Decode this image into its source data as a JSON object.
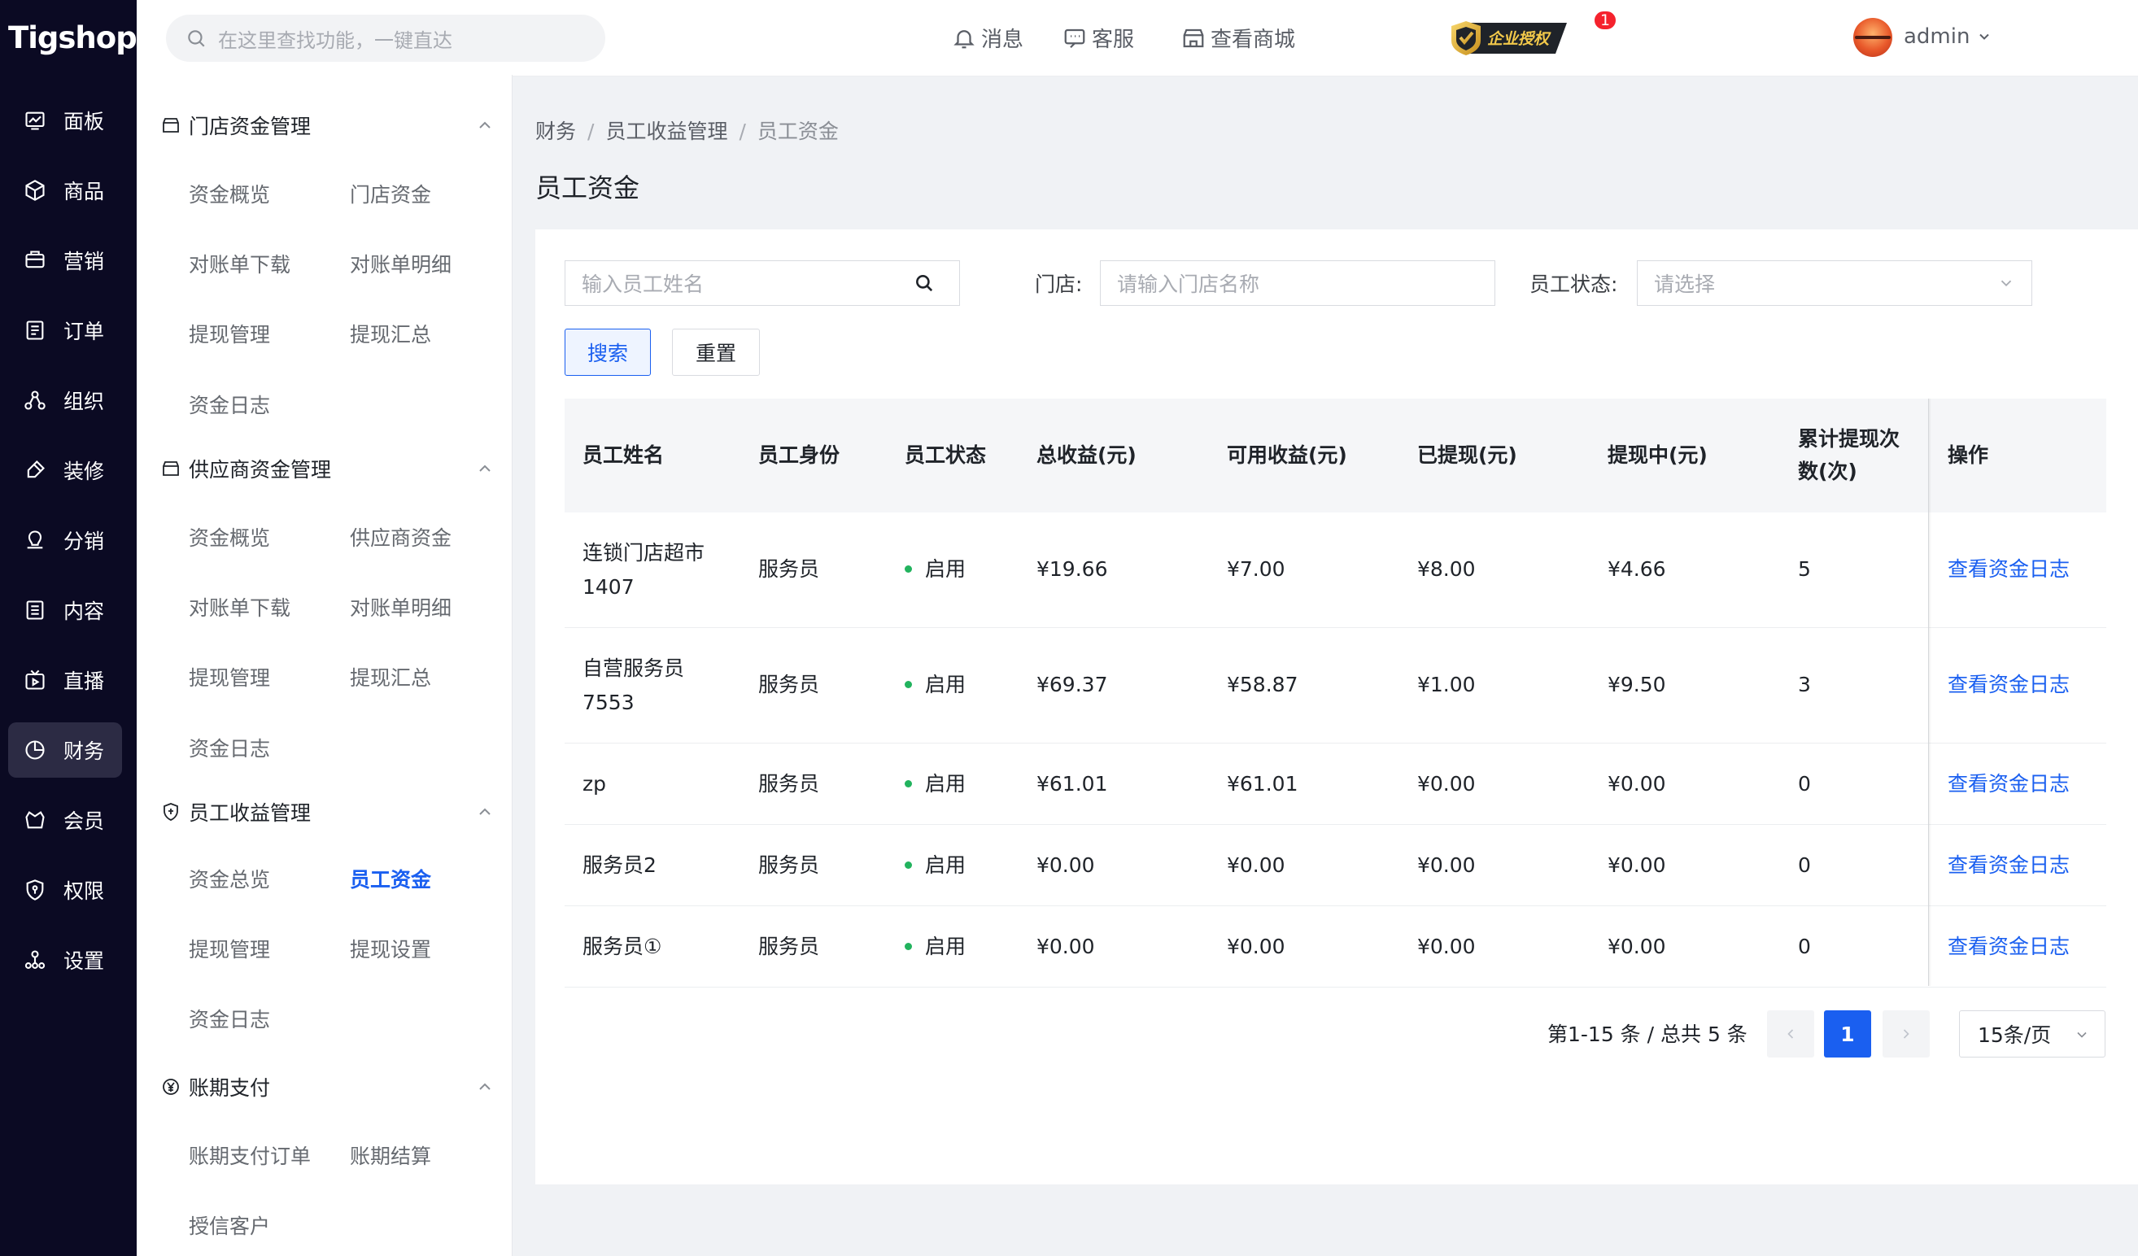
{
  "app": {
    "logo": "Tigshop"
  },
  "nav": {
    "items": [
      {
        "label": "面板",
        "icon": "chart-icon"
      },
      {
        "label": "商品",
        "icon": "box-icon"
      },
      {
        "label": "营销",
        "icon": "megaphone-icon"
      },
      {
        "label": "订单",
        "icon": "order-icon"
      },
      {
        "label": "组织",
        "icon": "org-icon"
      },
      {
        "label": "装修",
        "icon": "brush-icon"
      },
      {
        "label": "分销",
        "icon": "distribution-icon"
      },
      {
        "label": "内容",
        "icon": "content-icon"
      },
      {
        "label": "直播",
        "icon": "live-icon"
      },
      {
        "label": "财务",
        "icon": "finance-icon"
      },
      {
        "label": "会员",
        "icon": "member-icon"
      },
      {
        "label": "权限",
        "icon": "shield-icon"
      },
      {
        "label": "设置",
        "icon": "settings-icon"
      }
    ],
    "active": "财务"
  },
  "submenu": {
    "groups": [
      {
        "title": "门店资金管理",
        "items": [
          "资金概览",
          "门店资金",
          "对账单下载",
          "对账单明细",
          "提现管理",
          "提现汇总",
          "资金日志"
        ]
      },
      {
        "title": "供应商资金管理",
        "items": [
          "资金概览",
          "供应商资金",
          "对账单下载",
          "对账单明细",
          "提现管理",
          "提现汇总",
          "资金日志"
        ]
      },
      {
        "title": "员工收益管理",
        "items": [
          "资金总览",
          "员工资金",
          "提现管理",
          "提现设置",
          "资金日志"
        ]
      },
      {
        "title": "账期支付",
        "items": [
          "账期支付订单",
          "账期结算",
          "授信客户"
        ]
      }
    ],
    "active": "员工资金"
  },
  "topbar": {
    "search_placeholder": "在这里查找功能，一键直达",
    "auth_badge": "企业授权",
    "message_label": "消息",
    "message_count": "1",
    "service_label": "客服",
    "shop_label": "查看商城",
    "user": "admin"
  },
  "breadcrumb": [
    "财务",
    "员工收益管理",
    "员工资金"
  ],
  "page_title": "员工资金",
  "filters": {
    "name_placeholder": "输入员工姓名",
    "store_label": "门店:",
    "store_placeholder": "请输入门店名称",
    "status_label": "员工状态:",
    "status_placeholder": "请选择",
    "search_button": "搜索",
    "reset_button": "重置"
  },
  "table": {
    "headers": [
      "员工姓名",
      "员工身份",
      "员工状态",
      "总收益(元)",
      "可用收益(元)",
      "已提现(元)",
      "提现中(元)",
      "累计提现次",
      "数(次)",
      "操作"
    ],
    "rows": [
      {
        "name1": "连锁门店超市",
        "name2": "1407",
        "role": "服务员",
        "status": "启用",
        "total": "¥19.66",
        "available": "¥7.00",
        "withdrawn": "¥8.00",
        "pending": "¥4.66",
        "count": "5",
        "action": "查看资金日志"
      },
      {
        "name1": "自营服务员",
        "name2": "7553",
        "role": "服务员",
        "status": "启用",
        "total": "¥69.37",
        "available": "¥58.87",
        "withdrawn": "¥1.00",
        "pending": "¥9.50",
        "count": "3",
        "action": "查看资金日志"
      },
      {
        "name1": "zp",
        "name2": "",
        "role": "服务员",
        "status": "启用",
        "total": "¥61.01",
        "available": "¥61.01",
        "withdrawn": "¥0.00",
        "pending": "¥0.00",
        "count": "0",
        "action": "查看资金日志"
      },
      {
        "name1": "服务员2",
        "name2": "",
        "role": "服务员",
        "status": "启用",
        "total": "¥0.00",
        "available": "¥0.00",
        "withdrawn": "¥0.00",
        "pending": "¥0.00",
        "count": "0",
        "action": "查看资金日志"
      },
      {
        "name1": "服务员①",
        "name2": "",
        "role": "服务员",
        "status": "启用",
        "total": "¥0.00",
        "available": "¥0.00",
        "withdrawn": "¥0.00",
        "pending": "¥0.00",
        "count": "0",
        "action": "查看资金日志"
      }
    ]
  },
  "pagination": {
    "summary": "第1-15 条 / 总共 5 条",
    "current_page": "1",
    "page_size": "15条/页"
  },
  "colors": {
    "accent": "#1a5ff0",
    "nav_bg": "#0b0a23",
    "status_green": "#22b35e"
  }
}
